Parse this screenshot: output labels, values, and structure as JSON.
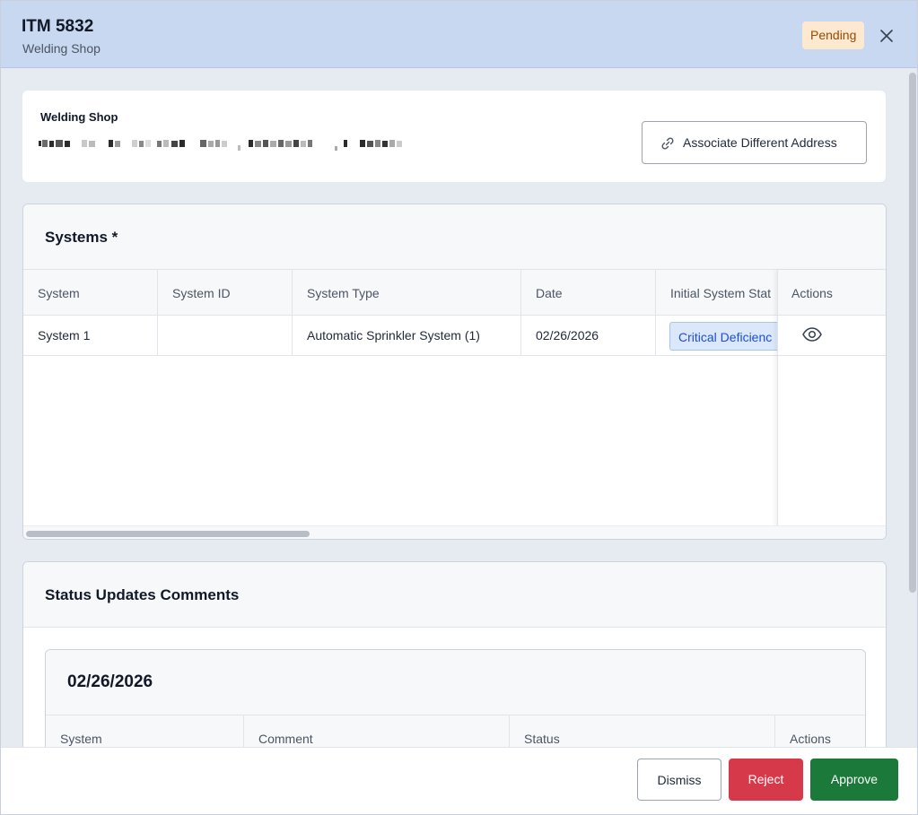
{
  "header": {
    "title": "ITM 5832",
    "subtitle": "Welding Shop",
    "status_badge": "Pending"
  },
  "address": {
    "name": "Welding Shop",
    "associate_button": "Associate Different Address"
  },
  "systems": {
    "title": "Systems *",
    "columns": [
      "System",
      "System ID",
      "System Type",
      "Date",
      "Initial System Stat",
      "Actions"
    ],
    "rows": [
      {
        "system": "System 1",
        "system_id": "",
        "system_type": "Automatic Sprinkler System (1)",
        "date": "02/26/2026",
        "initial_status": "Critical Deficienc"
      }
    ]
  },
  "status_updates": {
    "title": "Status Updates Comments",
    "groups": [
      {
        "date": "02/26/2026",
        "columns": [
          "System",
          "Comment",
          "Status",
          "Actions"
        ]
      }
    ]
  },
  "footer": {
    "dismiss": "Dismiss",
    "reject": "Reject",
    "approve": "Approve"
  },
  "colors": {
    "header_bg": "#c7d8f0",
    "pending_badge": "#fde9cf",
    "reject": "#d63a4a",
    "approve": "#1b7a3a",
    "critical_badge": "#dbe8fb"
  }
}
